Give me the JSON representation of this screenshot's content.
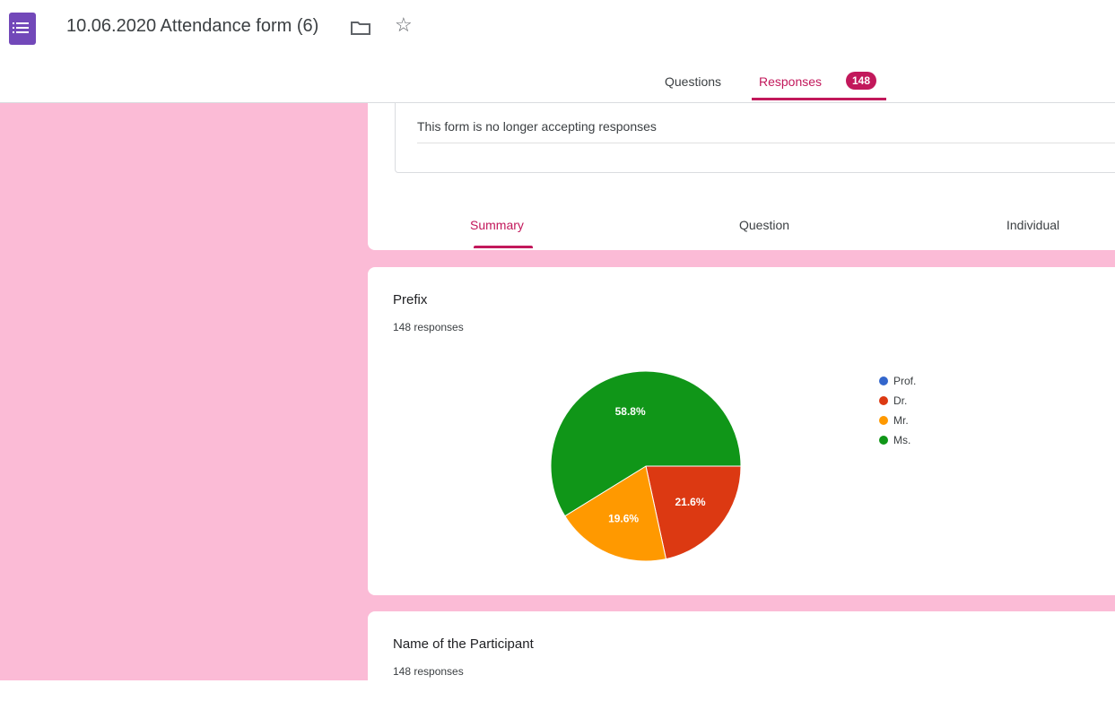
{
  "header": {
    "doc_title": "10.06.2020 Attendance form (6)",
    "icons": [
      "forms-app-icon",
      "folder-icon",
      "star-icon"
    ]
  },
  "tabs": {
    "questions": "Questions",
    "responses": "Responses",
    "responses_count": "148"
  },
  "status": {
    "closed_message": "This form is no longer accepting responses"
  },
  "view_tabs": {
    "summary": "Summary",
    "question": "Question",
    "individual": "Individual"
  },
  "questions": [
    {
      "title": "Prefix",
      "responses": "148 responses"
    },
    {
      "title": "Name of the Participant",
      "responses": "148 responses"
    }
  ],
  "chart_data": {
    "type": "pie",
    "categories": [
      "Prof.",
      "Dr.",
      "Mr.",
      "Ms."
    ],
    "values": [
      0,
      21.6,
      19.6,
      58.8
    ],
    "labels": [
      "",
      "21.6%",
      "19.6%",
      "58.8%"
    ],
    "colors": [
      "#3366cc",
      "#dc3912",
      "#ff9900",
      "#109618"
    ]
  },
  "colors": {
    "accent": "#c2185b",
    "background": "#fbbbd6",
    "forms_purple": "#7248b9"
  }
}
